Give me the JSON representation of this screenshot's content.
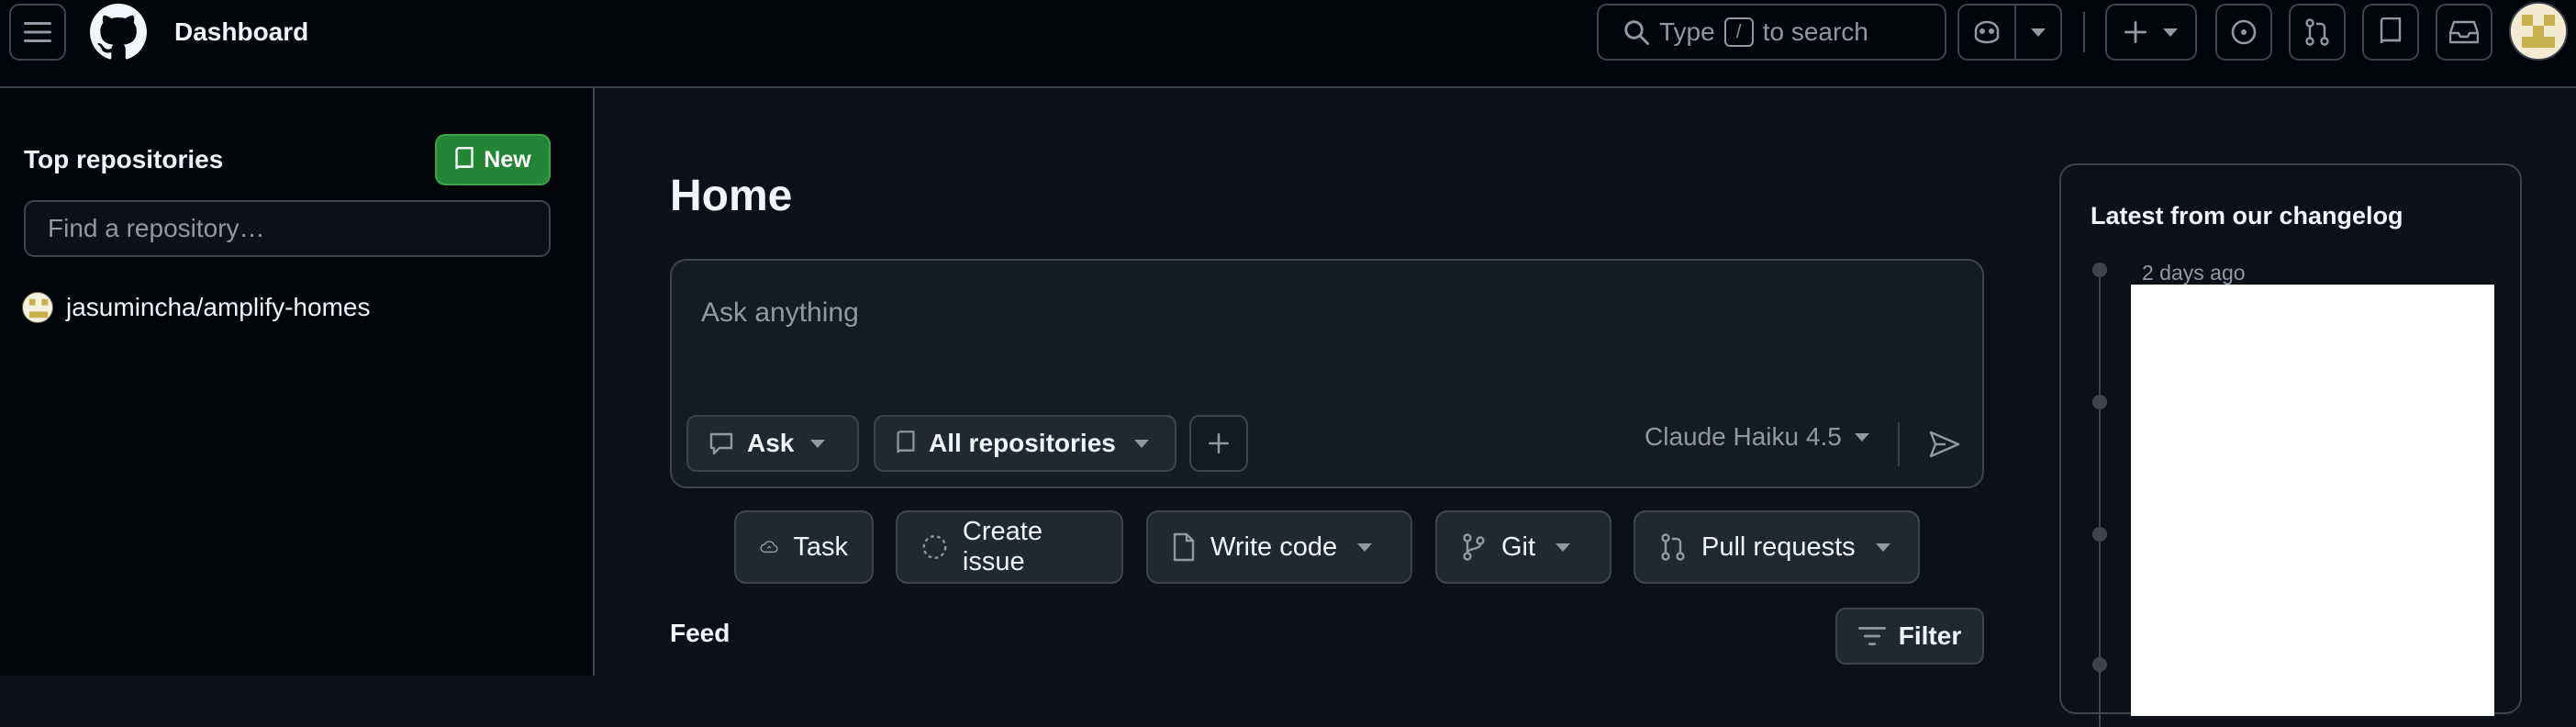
{
  "header": {
    "title": "Dashboard",
    "search_text_before": "Type",
    "search_key": "/",
    "search_text_after": "to search"
  },
  "sidebar": {
    "heading": "Top repositories",
    "new_label": "New",
    "find_placeholder": "Find a repository…",
    "repos": [
      {
        "name": "jasumincha/amplify-homes"
      }
    ]
  },
  "main": {
    "title": "Home",
    "ask_placeholder": "Ask anything",
    "mode_label": "Ask",
    "scope_label": "All repositories",
    "model_label": "Claude Haiku 4.5",
    "actions": [
      {
        "label": "Task"
      },
      {
        "label": "Create issue"
      },
      {
        "label": "Write code"
      },
      {
        "label": "Git"
      },
      {
        "label": "Pull requests"
      }
    ],
    "feed_label": "Feed",
    "filter_label": "Filter"
  },
  "changelog": {
    "heading": "Latest from our changelog",
    "entries": [
      {
        "date": "2 days ago"
      }
    ]
  },
  "colors": {
    "background": "#0d1117",
    "header_bg": "#010409",
    "border": "#3d444d",
    "new_button": "#238636",
    "muted_text": "#9198a1"
  }
}
